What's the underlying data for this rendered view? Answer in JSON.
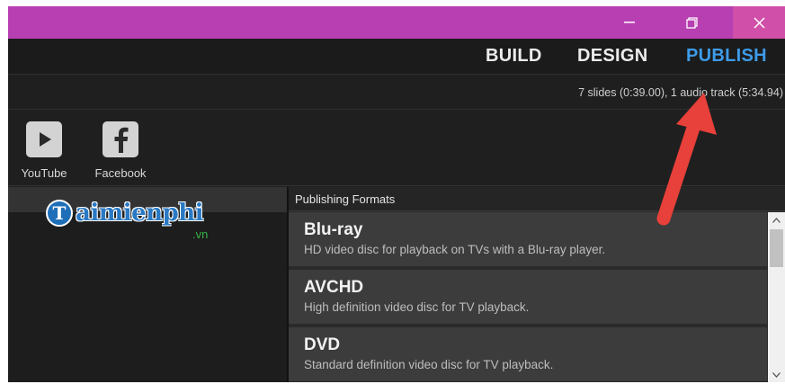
{
  "window": {
    "titlebar_color": "#b73fb1",
    "controls": {
      "minimize_icon": "minimize-icon",
      "maximize_icon": "maximize-icon",
      "close_icon": "close-icon"
    }
  },
  "nav": {
    "tabs": [
      {
        "label": "BUILD",
        "active": false
      },
      {
        "label": "DESIGN",
        "active": false
      },
      {
        "label": "PUBLISH",
        "active": true
      }
    ],
    "active_color": "#3d9be9"
  },
  "info": {
    "summary": "7 slides (0:39.00), 1 audio track (5:34.94)"
  },
  "share": {
    "items": [
      {
        "label": "YouTube",
        "icon": "youtube-icon"
      },
      {
        "label": "Facebook",
        "icon": "facebook-icon"
      }
    ]
  },
  "watermark": {
    "logo_letter": "T",
    "name": "aimienphi",
    "suffix": ".vn"
  },
  "formats": {
    "title": "Publishing Formats",
    "items": [
      {
        "name": "Blu-ray",
        "description": "HD video disc for playback on TVs with a Blu-ray player."
      },
      {
        "name": "AVCHD",
        "description": "High definition video disc for TV playback."
      },
      {
        "name": "DVD",
        "description": "Standard definition video disc for TV playback."
      }
    ]
  },
  "annotation": {
    "arrow_color": "#e8403a",
    "points_to": "PUBLISH"
  }
}
